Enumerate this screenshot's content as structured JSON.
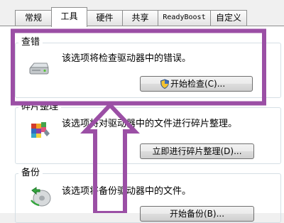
{
  "tabs": [
    {
      "label": "常规",
      "active": false
    },
    {
      "label": "工具",
      "active": true
    },
    {
      "label": "硬件",
      "active": false
    },
    {
      "label": "共享",
      "active": false
    },
    {
      "label": "ReadyBoost",
      "active": false
    },
    {
      "label": "自定义",
      "active": false
    }
  ],
  "error_check": {
    "title": "查错",
    "description": "该选项将检查驱动器中的错误。",
    "button_label": "开始检查(C)...",
    "icon": "drive-icon"
  },
  "defrag": {
    "title": "碎片整理",
    "description": "该选项将对驱动器中的文件进行碎片整理。",
    "button_label": "立即进行碎片整理(D)...",
    "icon": "defrag-icon"
  },
  "backup": {
    "title": "备份",
    "description": "该选项将备份驱动器中的文件。",
    "button_label": "开始备份(B)...",
    "icon": "backup-icon"
  },
  "annotation": {
    "color": "#9b4fa5",
    "shapes": [
      "highlight-rectangle",
      "up-arrow"
    ]
  }
}
